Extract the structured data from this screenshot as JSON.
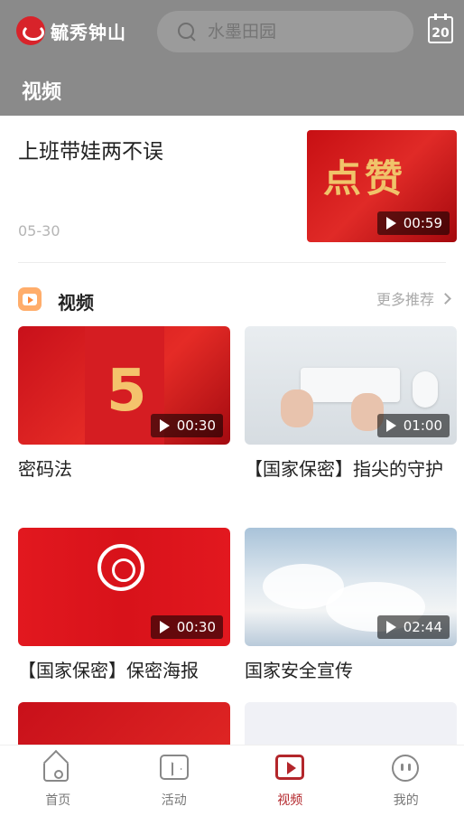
{
  "header": {
    "app_name": "毓秀钟山",
    "search_placeholder": "水墨田园",
    "calendar_day": "20",
    "page_title": "视频"
  },
  "top_article": {
    "title": "上班带娃两不误",
    "date": "05-30",
    "thumb_text": "点赞",
    "duration": "00:59"
  },
  "section": {
    "title": "视频",
    "more_label": "更多推荐"
  },
  "videos": [
    {
      "title": "密码法",
      "duration": "00:30"
    },
    {
      "title": "【国家保密】指尖的守护",
      "duration": "01:00"
    },
    {
      "title": "【国家保密】保密海报",
      "duration": "00:30"
    },
    {
      "title": "国家安全宣传",
      "duration": "02:44"
    }
  ],
  "bottom_nav": [
    {
      "label": "首页",
      "icon": "home-icon"
    },
    {
      "label": "活动",
      "icon": "activity-icon"
    },
    {
      "label": "视频",
      "icon": "video-icon",
      "active": true
    },
    {
      "label": "我的",
      "icon": "profile-icon"
    }
  ],
  "colors": {
    "header_bg": "#8a8a8a",
    "accent": "#b3262b"
  }
}
